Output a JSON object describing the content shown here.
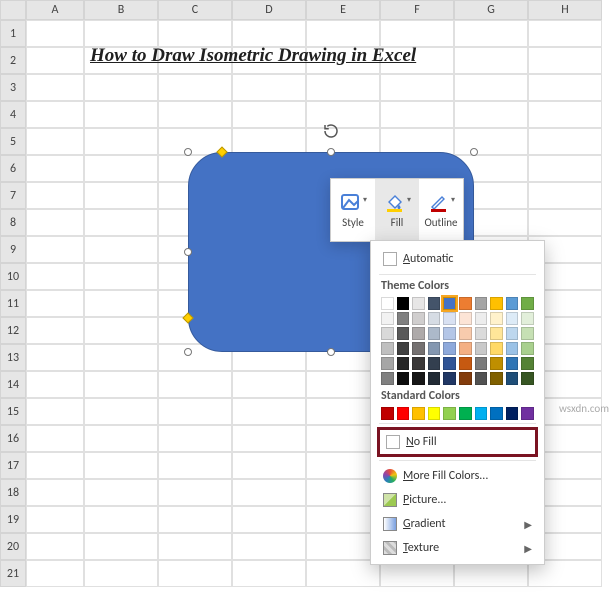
{
  "grid": {
    "columns": [
      "A",
      "B",
      "C",
      "D",
      "E",
      "F",
      "G",
      "H"
    ],
    "rows": [
      "1",
      "2",
      "3",
      "4",
      "5",
      "6",
      "7",
      "8",
      "9",
      "10",
      "11",
      "12",
      "13",
      "14",
      "15",
      "16",
      "17",
      "18",
      "19",
      "20",
      "21"
    ]
  },
  "title": "How to Draw Isometric Drawing in Excel",
  "shape_fill": "#4472C4",
  "mini_toolbar": {
    "style": "Style",
    "fill": "Fill",
    "outline": "Outline"
  },
  "fill_menu": {
    "automatic": "Automatic",
    "theme_heading": "Theme Colors",
    "theme_row1": [
      "#FFFFFF",
      "#000000",
      "#E7E6E6",
      "#44546A",
      "#4472C4",
      "#ED7D31",
      "#A5A5A5",
      "#FFC000",
      "#5B9BD5",
      "#70AD47"
    ],
    "theme_selected_index": 4,
    "theme_shades": [
      [
        "#F2F2F2",
        "#808080",
        "#D0CECE",
        "#D6DCE4",
        "#D9E1F2",
        "#FCE4D6",
        "#EDEDED",
        "#FFF2CC",
        "#DDEBF7",
        "#E2EFDA"
      ],
      [
        "#D9D9D9",
        "#595959",
        "#AEAAAA",
        "#ACB9CA",
        "#B4C6E7",
        "#F8CBAD",
        "#DBDBDB",
        "#FFE699",
        "#BDD7EE",
        "#C6E0B4"
      ],
      [
        "#BFBFBF",
        "#404040",
        "#757171",
        "#8497B0",
        "#8EA9DB",
        "#F4B084",
        "#C9C9C9",
        "#FFD966",
        "#9BC2E6",
        "#A9D08E"
      ],
      [
        "#A6A6A6",
        "#262626",
        "#3A3838",
        "#333F4F",
        "#305496",
        "#C65911",
        "#7B7B7B",
        "#BF8F00",
        "#2F75B5",
        "#548235"
      ],
      [
        "#808080",
        "#0D0D0D",
        "#161616",
        "#222B35",
        "#203764",
        "#833C0C",
        "#525252",
        "#806000",
        "#1F4E78",
        "#375623"
      ]
    ],
    "standard_heading": "Standard Colors",
    "standard_colors": [
      "#C00000",
      "#FF0000",
      "#FFC000",
      "#FFFF00",
      "#92D050",
      "#00B050",
      "#00B0F0",
      "#0070C0",
      "#002060",
      "#7030A0"
    ],
    "no_fill": "No Fill",
    "more_colors": "More Fill Colors...",
    "picture": "Picture...",
    "gradient": "Gradient",
    "texture": "Texture"
  },
  "watermark": "wsxdn.com"
}
